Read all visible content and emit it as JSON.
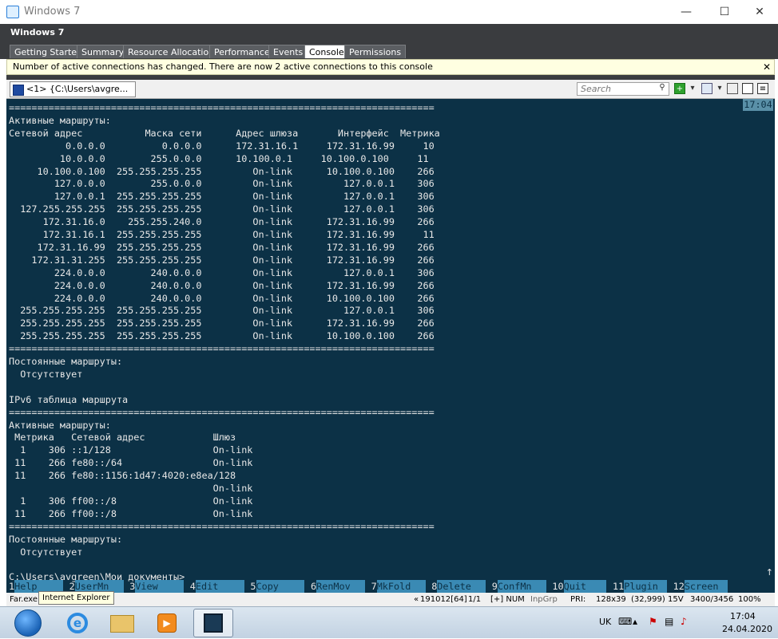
{
  "window": {
    "title": "Windows 7",
    "minimize": "—",
    "maximize": "☐",
    "close": "✕"
  },
  "vsphere": {
    "vm_name": "Windows 7",
    "tabs": [
      "Getting Started",
      "Summary",
      "Resource Allocation",
      "Performance",
      "Events",
      "Console",
      "Permissions"
    ],
    "active_tab": "Console",
    "notice": "Number of active connections has changed. There are now 2 active connections to this console",
    "notice_close": "✕"
  },
  "conemu": {
    "tab_label": "<1> {C:\\Users\\avgre...",
    "search_placeholder": "Search",
    "clock": "17:04"
  },
  "console": {
    "lines": [
      "===========================================================================",
      "Активные маршруты:",
      "Сетевой адрес           Маска сети      Адрес шлюза       Интерфейс  Метрика",
      "          0.0.0.0          0.0.0.0      172.31.16.1     172.31.16.99     10",
      "         10.0.0.0        255.0.0.0      10.100.0.1     10.100.0.100     11",
      "     10.100.0.100  255.255.255.255         On-link      10.100.0.100    266",
      "        127.0.0.0        255.0.0.0         On-link         127.0.0.1    306",
      "        127.0.0.1  255.255.255.255         On-link         127.0.0.1    306",
      "  127.255.255.255  255.255.255.255         On-link         127.0.0.1    306",
      "      172.31.16.0    255.255.240.0         On-link      172.31.16.99    266",
      "      172.31.16.1  255.255.255.255         On-link      172.31.16.99     11",
      "     172.31.16.99  255.255.255.255         On-link      172.31.16.99    266",
      "    172.31.31.255  255.255.255.255         On-link      172.31.16.99    266",
      "        224.0.0.0        240.0.0.0         On-link         127.0.0.1    306",
      "        224.0.0.0        240.0.0.0         On-link      172.31.16.99    266",
      "        224.0.0.0        240.0.0.0         On-link      10.100.0.100    266",
      "  255.255.255.255  255.255.255.255         On-link         127.0.0.1    306",
      "  255.255.255.255  255.255.255.255         On-link      172.31.16.99    266",
      "  255.255.255.255  255.255.255.255         On-link      10.100.0.100    266",
      "===========================================================================",
      "Постоянные маршруты:",
      "  Отсутствует",
      "",
      "IPv6 таблица маршрута",
      "===========================================================================",
      "Активные маршруты:",
      " Метрика   Сетевой адрес            Шлюз",
      "  1    306 ::1/128                  On-link",
      " 11    266 fe80::/64                On-link",
      " 11    266 fe80::1156:1d47:4020:e8ea/128",
      "                                    On-link",
      "  1    306 ff00::/8                 On-link",
      " 11    266 ff00::/8                 On-link",
      "===========================================================================",
      "Постоянные маршруты:",
      "  Отсутствует",
      "",
      "C:\\Users\\avgreen\\Мои документы>"
    ],
    "fkeys": [
      {
        "n": "1",
        "l": "Help"
      },
      {
        "n": "2",
        "l": "UserMn"
      },
      {
        "n": "3",
        "l": "View"
      },
      {
        "n": "4",
        "l": "Edit"
      },
      {
        "n": "5",
        "l": "Copy"
      },
      {
        "n": "6",
        "l": "RenMov"
      },
      {
        "n": "7",
        "l": "MkFold"
      },
      {
        "n": "8",
        "l": "Delete"
      },
      {
        "n": "9",
        "l": "ConfMn"
      },
      {
        "n": "10",
        "l": "Quit"
      },
      {
        "n": "11",
        "l": "Plugin"
      },
      {
        "n": "12",
        "l": "Screen"
      }
    ],
    "scroll_arrow": "↑"
  },
  "statusbar": {
    "process": "Far.exe",
    "tooltip": "Internet Explorer",
    "marker": "«",
    "items": [
      "191012[64]",
      "1/1",
      "[+] NUM",
      "InpGrp",
      "PRI:",
      "128x39",
      "(32,999) 15V",
      "3400/3456",
      "100%"
    ]
  },
  "taskbar": {
    "lang": "UK",
    "time": "17:04",
    "date": "24.04.2020"
  },
  "colors": {
    "console_bg": "#0c3146",
    "fkey_bg": "#3a8ab4",
    "header_bg": "#3a3c3f"
  }
}
